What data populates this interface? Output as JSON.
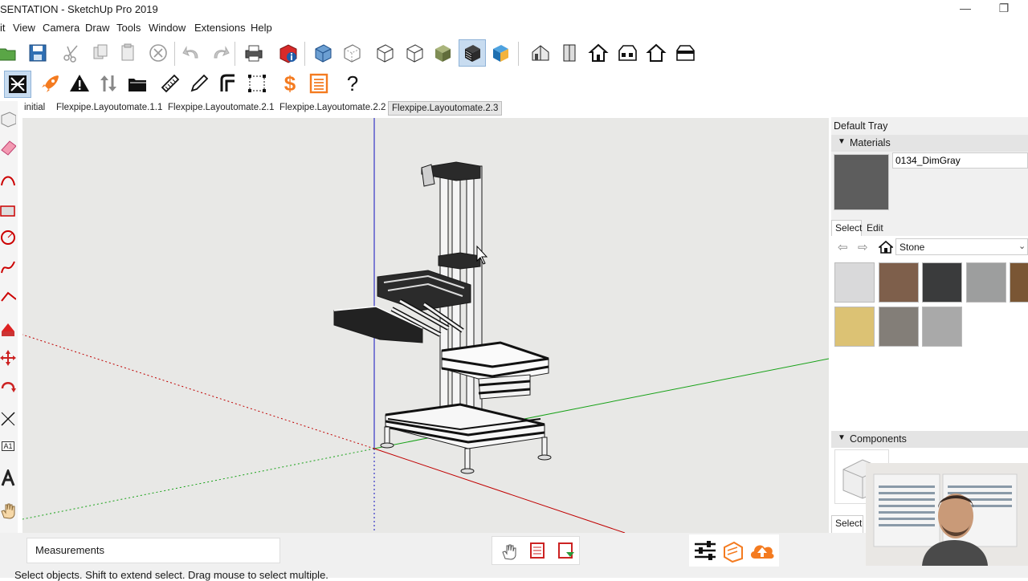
{
  "window": {
    "title": "SENTATION - SketchUp Pro 2019",
    "minimize_glyph": "—",
    "restore_glyph": "❐"
  },
  "menubar": {
    "items": [
      "it",
      "View",
      "Camera",
      "Draw",
      "Tools",
      "Window",
      "Extensions",
      "Help"
    ]
  },
  "toolbar": {
    "help_glyph": "?",
    "dollar_glyph": "$"
  },
  "scenes": {
    "tabs": [
      "initial",
      "Flexpipe.Layoutomate.1.1",
      "Flexpipe.Layoutomate.2.1",
      "Flexpipe.Layoutomate.2.2",
      "Flexpipe.Layoutomate.2.3"
    ],
    "active_index": 4
  },
  "lefttools": {
    "text_tool_label": "A1"
  },
  "tray": {
    "title": "Default Tray",
    "materials": {
      "header": "Materials",
      "current_material": "0134_DimGray",
      "current_color": "#5d5d5d",
      "tabs": [
        "Select",
        "Edit"
      ],
      "library": "Stone",
      "swatches": [
        {
          "name": "white-marble",
          "color": "#d9d9da"
        },
        {
          "name": "brown-granite",
          "color": "#7e5f4b"
        },
        {
          "name": "dark-granite",
          "color": "#3a3b3c"
        },
        {
          "name": "gray-granite",
          "color": "#9d9e9e"
        },
        {
          "name": "brown-stone",
          "color": "#7a5634"
        },
        {
          "name": "sandstone",
          "color": "#dcc274"
        },
        {
          "name": "mottled-gray",
          "color": "#837e78"
        },
        {
          "name": "light-gray-granite",
          "color": "#a9a9a9"
        }
      ]
    },
    "components": {
      "header": "Components",
      "select_tab": "Select"
    }
  },
  "status": {
    "measurements_label": "Measurements",
    "hint": "Select objects. Shift to extend select. Drag mouse to select multiple."
  },
  "colors": {
    "accent_orange": "#f47b20",
    "sky": "#e8e8e6",
    "axis_red": "#c00000",
    "axis_green": "#16a116",
    "axis_blue": "#1010c0"
  }
}
